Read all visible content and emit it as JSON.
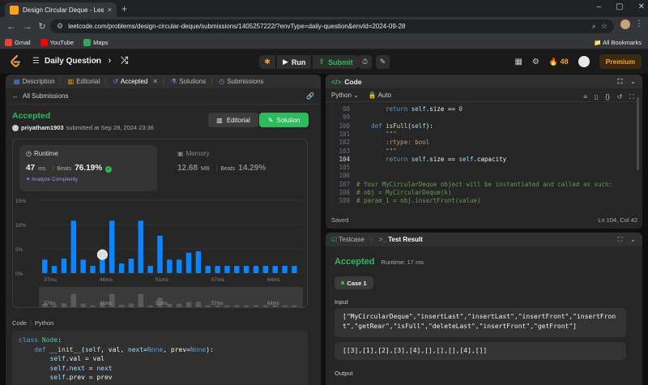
{
  "browser": {
    "tab_title": "Design Circular Deque - LeetCode",
    "tab_close": "×",
    "new_tab": "+",
    "url": "leetcode.com/problems/design-circular-deque/submissions/1405257222/?envType=daily-question&envId=2024-09-28",
    "bookmarks": [
      "Gmail",
      "YouTube",
      "Maps"
    ],
    "all_bookmarks": "All Bookmarks"
  },
  "header": {
    "daily_question": "Daily Question",
    "run_label": "Run",
    "submit_label": "Submit",
    "streak": "48",
    "premium": "Premium"
  },
  "left_tabs": [
    {
      "label": "Description"
    },
    {
      "label": "Editorial"
    },
    {
      "label": "Accepted"
    },
    {
      "label": "Solutions"
    },
    {
      "label": "Submissions"
    }
  ],
  "submission": {
    "back_label": "All Submissions",
    "status": "Accepted",
    "user": "priyatham1903",
    "submitted_text": "submitted at Sep 28, 2024 23:36",
    "editorial_button": "Editorial",
    "solution_button": "Solution"
  },
  "runtime": {
    "label": "Runtime",
    "value": "47",
    "unit": "ms",
    "beats_label": "Beats",
    "beats": "76.19%",
    "analyze": "Analyze Complexity"
  },
  "memory": {
    "label": "Memory",
    "value": "12.68",
    "unit": "MB",
    "beats_label": "Beats",
    "beats": "14.29%"
  },
  "chart_data": {
    "type": "bar",
    "title": "",
    "xlabel": "",
    "ylabel": "",
    "y_ticks": [
      "15%",
      "10%",
      "5%",
      "0%"
    ],
    "ylim": [
      0,
      15
    ],
    "x_ticks": [
      "37ms",
      "46ms",
      "51ms",
      "57ms",
      "64ms"
    ],
    "values": [
      2.8,
      1.5,
      3.0,
      10.8,
      2.8,
      1.5,
      2.8,
      10.8,
      2.0,
      3.0,
      10.8,
      1.5,
      7.7,
      2.8,
      2.8,
      4.2,
      4.5,
      1.5,
      1.5,
      1.5,
      1.5,
      1.5,
      1.5,
      1.5,
      1.5,
      1.5,
      1.5
    ],
    "highlight_index": 6,
    "bar_color": "#0a84ff",
    "grid": true
  },
  "code_section": {
    "label": "Code",
    "lang": "Python",
    "lines": [
      "class Node:",
      "    def __init__(self, val, next=None, prev=None):",
      "        self.val = val",
      "        self.next = next",
      "        self.prev = prev"
    ]
  },
  "editor": {
    "title": "Code",
    "language": "Python",
    "mode": "Auto",
    "line_numbers": [
      "98",
      "99",
      "100",
      "101",
      "102",
      "103",
      "104",
      "105",
      "106",
      "107",
      "108",
      "109"
    ],
    "current_line": "104",
    "lines": [
      "        return self.size == 0",
      "",
      "    def isFull(self):",
      "        \"\"\"",
      "        :rtype: bool",
      "        \"\"\"",
      "        return self.size == self.capacity",
      "",
      "",
      "# Your MyCircularDeque object will be instantiated and called as such:",
      "# obj = MyCircularDeque(k)",
      "# param_1 = obj.insertFront(value)"
    ],
    "saved": "Saved",
    "position": "Ln 104, Col 42"
  },
  "testpanel": {
    "tab_testcase": "Testcase",
    "tab_result": "Test Result",
    "status": "Accepted",
    "runtime": "Runtime: 17 ms",
    "case_label": "Case 1",
    "input_label": "Input",
    "input_line1": "[\"MyCircularDeque\",\"insertLast\",\"insertLast\",\"insertFront\",\"insertFront\",\"getRear\",\"isFull\",\"deleteLast\",\"insertFront\",\"getFront\"]",
    "input_line2": "[[3],[1],[2],[3],[4],[],[],[],[4],[]]",
    "output_label": "Output"
  }
}
